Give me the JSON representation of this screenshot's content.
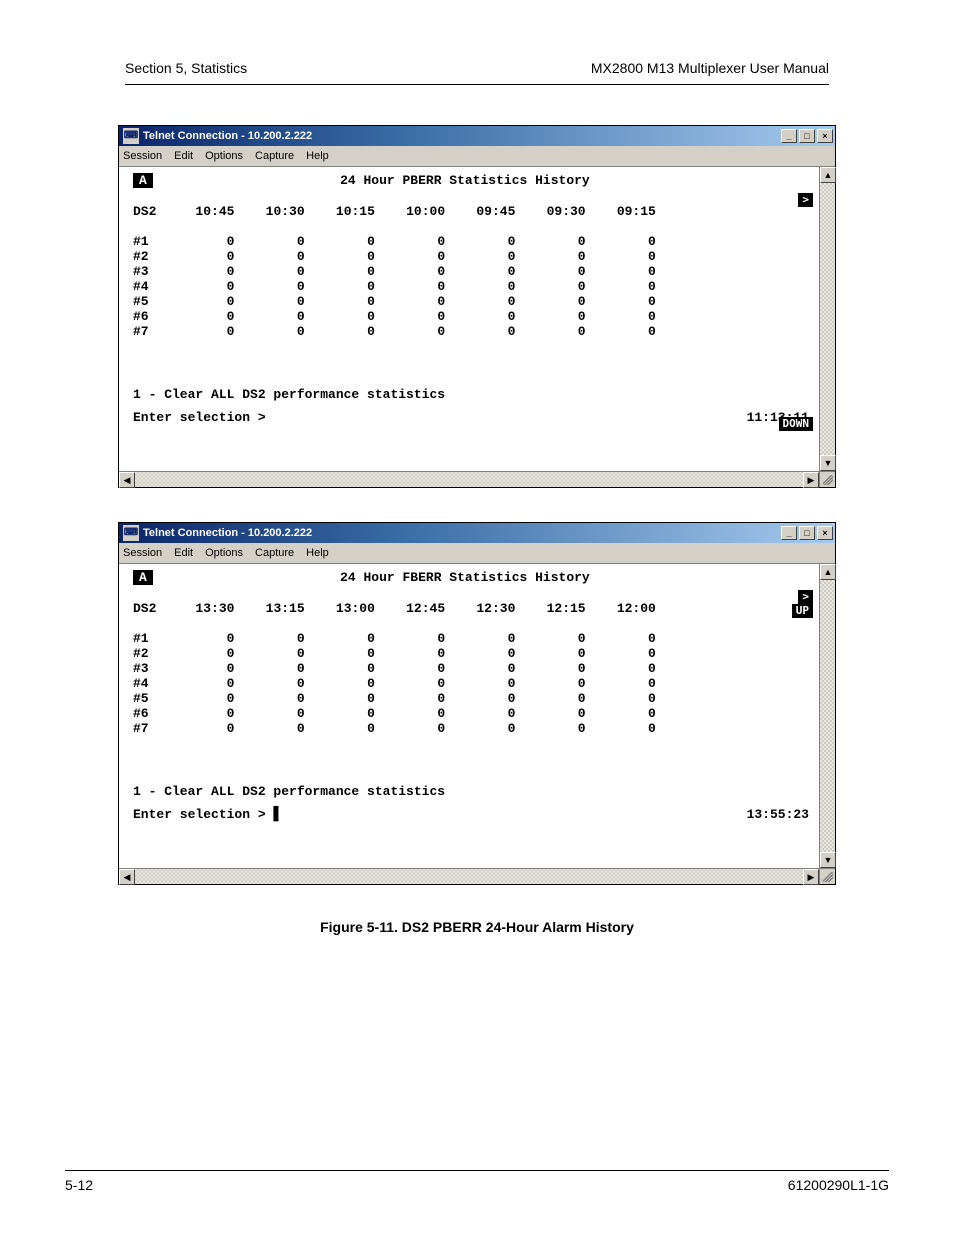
{
  "header": {
    "left": "Section 5, Statistics",
    "right": "MX2800 M13 Multiplexer User Manual"
  },
  "caption": "Figure 5-11.  DS2 PBERR 24-Hour Alarm History",
  "footer": {
    "left": "5-12",
    "right": "61200290L1-1G"
  },
  "win_shared": {
    "title": "Telnet Connection - 10.200.2.222",
    "menus": [
      "Session",
      "Edit",
      "Options",
      "Capture",
      "Help"
    ],
    "btn_min": "_",
    "btn_max": "□",
    "btn_close": "×",
    "scroll_up": "▲",
    "scroll_down": "▼",
    "scroll_left": "◀",
    "scroll_right": "▶",
    "badge": "A",
    "arrow_pill": ">"
  },
  "win1": {
    "term_title": "24 Hour PBERR Statistics History",
    "down_label": "DOWN",
    "col_label": "DS2",
    "cols": [
      "10:45",
      "10:30",
      "10:15",
      "10:00",
      "09:45",
      "09:30",
      "09:15"
    ],
    "rows": [
      "#1",
      "#2",
      "#3",
      "#4",
      "#5",
      "#6",
      "#7"
    ],
    "cells": [
      [
        "0",
        "0",
        "0",
        "0",
        "0",
        "0",
        "0"
      ],
      [
        "0",
        "0",
        "0",
        "0",
        "0",
        "0",
        "0"
      ],
      [
        "0",
        "0",
        "0",
        "0",
        "0",
        "0",
        "0"
      ],
      [
        "0",
        "0",
        "0",
        "0",
        "0",
        "0",
        "0"
      ],
      [
        "0",
        "0",
        "0",
        "0",
        "0",
        "0",
        "0"
      ],
      [
        "0",
        "0",
        "0",
        "0",
        "0",
        "0",
        "0"
      ],
      [
        "0",
        "0",
        "0",
        "0",
        "0",
        "0",
        "0"
      ]
    ],
    "clear_line": "1 - Clear ALL DS2 performance statistics",
    "prompt": "Enter selection >",
    "clock": "11:13:11"
  },
  "win2": {
    "term_title": "24 Hour FBERR Statistics History",
    "up_label": "UP",
    "col_label": "DS2",
    "cols": [
      "13:30",
      "13:15",
      "13:00",
      "12:45",
      "12:30",
      "12:15",
      "12:00"
    ],
    "rows": [
      "#1",
      "#2",
      "#3",
      "#4",
      "#5",
      "#6",
      "#7"
    ],
    "cells": [
      [
        "0",
        "0",
        "0",
        "0",
        "0",
        "0",
        "0"
      ],
      [
        "0",
        "0",
        "0",
        "0",
        "0",
        "0",
        "0"
      ],
      [
        "0",
        "0",
        "0",
        "0",
        "0",
        "0",
        "0"
      ],
      [
        "0",
        "0",
        "0",
        "0",
        "0",
        "0",
        "0"
      ],
      [
        "0",
        "0",
        "0",
        "0",
        "0",
        "0",
        "0"
      ],
      [
        "0",
        "0",
        "0",
        "0",
        "0",
        "0",
        "0"
      ],
      [
        "0",
        "0",
        "0",
        "0",
        "0",
        "0",
        "0"
      ]
    ],
    "clear_line": "1 - Clear ALL DS2 performance statistics",
    "prompt": "Enter selection > ",
    "cursor": "▋",
    "clock": "13:55:23"
  }
}
